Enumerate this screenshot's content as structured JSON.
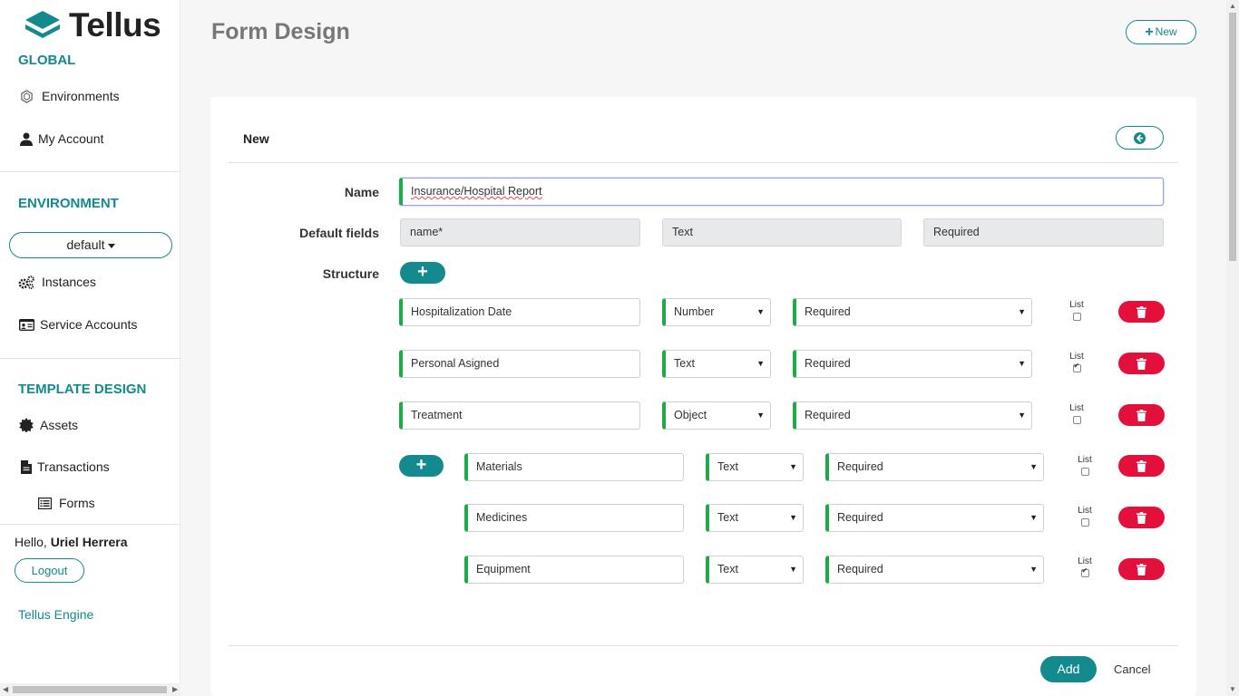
{
  "brand": {
    "name": "Tellus"
  },
  "sidebar": {
    "global_title": "GLOBAL",
    "global_items": [
      {
        "label": "Environments",
        "icon": "hexagon-icon"
      },
      {
        "label": "My Account",
        "icon": "user-icon"
      }
    ],
    "environment_title": "ENVIRONMENT",
    "environment_select": "default",
    "environment_items": [
      {
        "label": "Instances",
        "icon": "gears-icon"
      },
      {
        "label": "Service Accounts",
        "icon": "id-card-icon"
      }
    ],
    "template_title": "TEMPLATE DESIGN",
    "template_items": [
      {
        "label": "Assets",
        "icon": "certificate-icon"
      },
      {
        "label": "Transactions",
        "icon": "file-icon"
      },
      {
        "label": "Forms",
        "icon": "list-icon"
      }
    ],
    "hello_prefix": "Hello,",
    "user_name": "Uriel Herrera",
    "logout": "Logout",
    "engine_link": "Tellus Engine"
  },
  "page": {
    "title": "Form Design",
    "new_button": "New"
  },
  "form": {
    "card_title": "New",
    "name_label": "Name",
    "name_value": "Insurance/Hospital Report",
    "default_fields_label": "Default fields",
    "default_fields": [
      "name*",
      "Text",
      "Required"
    ],
    "structure_label": "Structure",
    "list_label": "List",
    "rows": [
      {
        "name": "Hospitalization Date",
        "type": "Number",
        "requirement": "Required",
        "list": false
      },
      {
        "name": "Personal Asigned",
        "type": "Text",
        "requirement": "Required",
        "list": true
      },
      {
        "name": "Treatment",
        "type": "Object",
        "requirement": "Required",
        "list": false
      }
    ],
    "sub_rows": [
      {
        "name": "Materials",
        "type": "Text",
        "requirement": "Required",
        "list": false
      },
      {
        "name": "Medicines",
        "type": "Text",
        "requirement": "Required",
        "list": false
      },
      {
        "name": "Equipment",
        "type": "Text",
        "requirement": "Required",
        "list": true
      }
    ],
    "add_button": "Add",
    "cancel_button": "Cancel"
  },
  "colors": {
    "accent": "#128a8e",
    "danger": "#e4103c",
    "field_marker": "#1faa4a"
  }
}
